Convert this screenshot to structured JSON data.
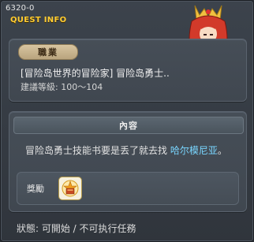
{
  "quest": {
    "id": "6320-0",
    "header": "QUEST INFO"
  },
  "job": {
    "label": "職業",
    "name": "[冒险岛世界的冒险家] 冒险岛勇士..",
    "level": "建議等級: 100～104"
  },
  "content": {
    "header": "內容",
    "text_before": "冒险岛勇士技能书要是丢了就去找 ",
    "highlight": "哈尔模尼亚",
    "text_after": "。"
  },
  "reward": {
    "label": "獎勵",
    "item_icon": "skill-book-icon"
  },
  "status": {
    "text": "狀態: 可開始 / 不可执行任務"
  },
  "colors": {
    "title": "#ffcc33",
    "highlight": "#79d6ff",
    "pill": "#d8c5a0"
  }
}
